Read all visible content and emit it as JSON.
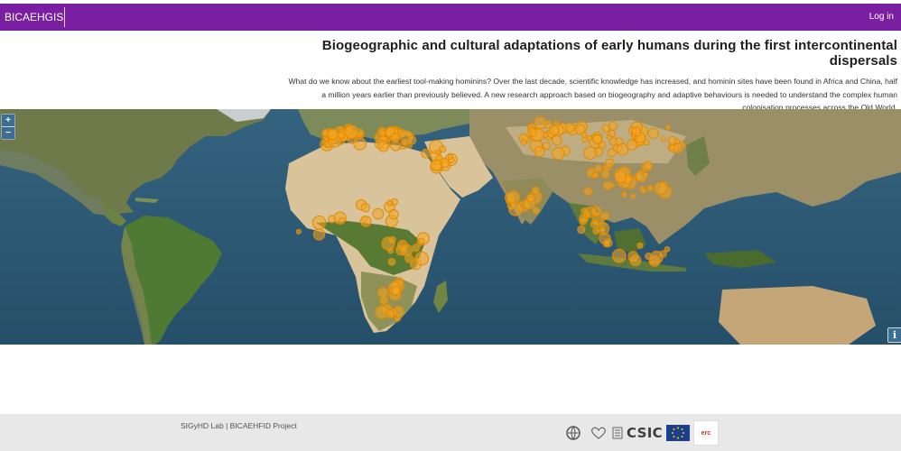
{
  "navbar": {
    "brand": "BICAEHGIS",
    "login": "Log in",
    "color": "#7b1fa2"
  },
  "header": {
    "title": "Biogeographic and cultural adaptations of early humans during the first intercontinental dispersals",
    "description_lines": [
      "What do we know about the earliest tool-making hominins? Over the last decade, scientific knowledge has increased, and hominin sites have been found in Africa and China, half",
      "a million years earlier than previously believed. A new research approach based on biogeography and adaptive behaviours is needed to understand the complex human",
      "colonisation processes across the Old World."
    ]
  },
  "map": {
    "zoom_in": "+",
    "zoom_out": "−",
    "info": "i",
    "marker_color": "#f5a623",
    "ocean_color": "#2f5b76"
  },
  "footer": {
    "text": "SIGyHD Lab | BICAEHFID Project",
    "logos": {
      "csic": "CSIC",
      "erc": "erc"
    }
  }
}
